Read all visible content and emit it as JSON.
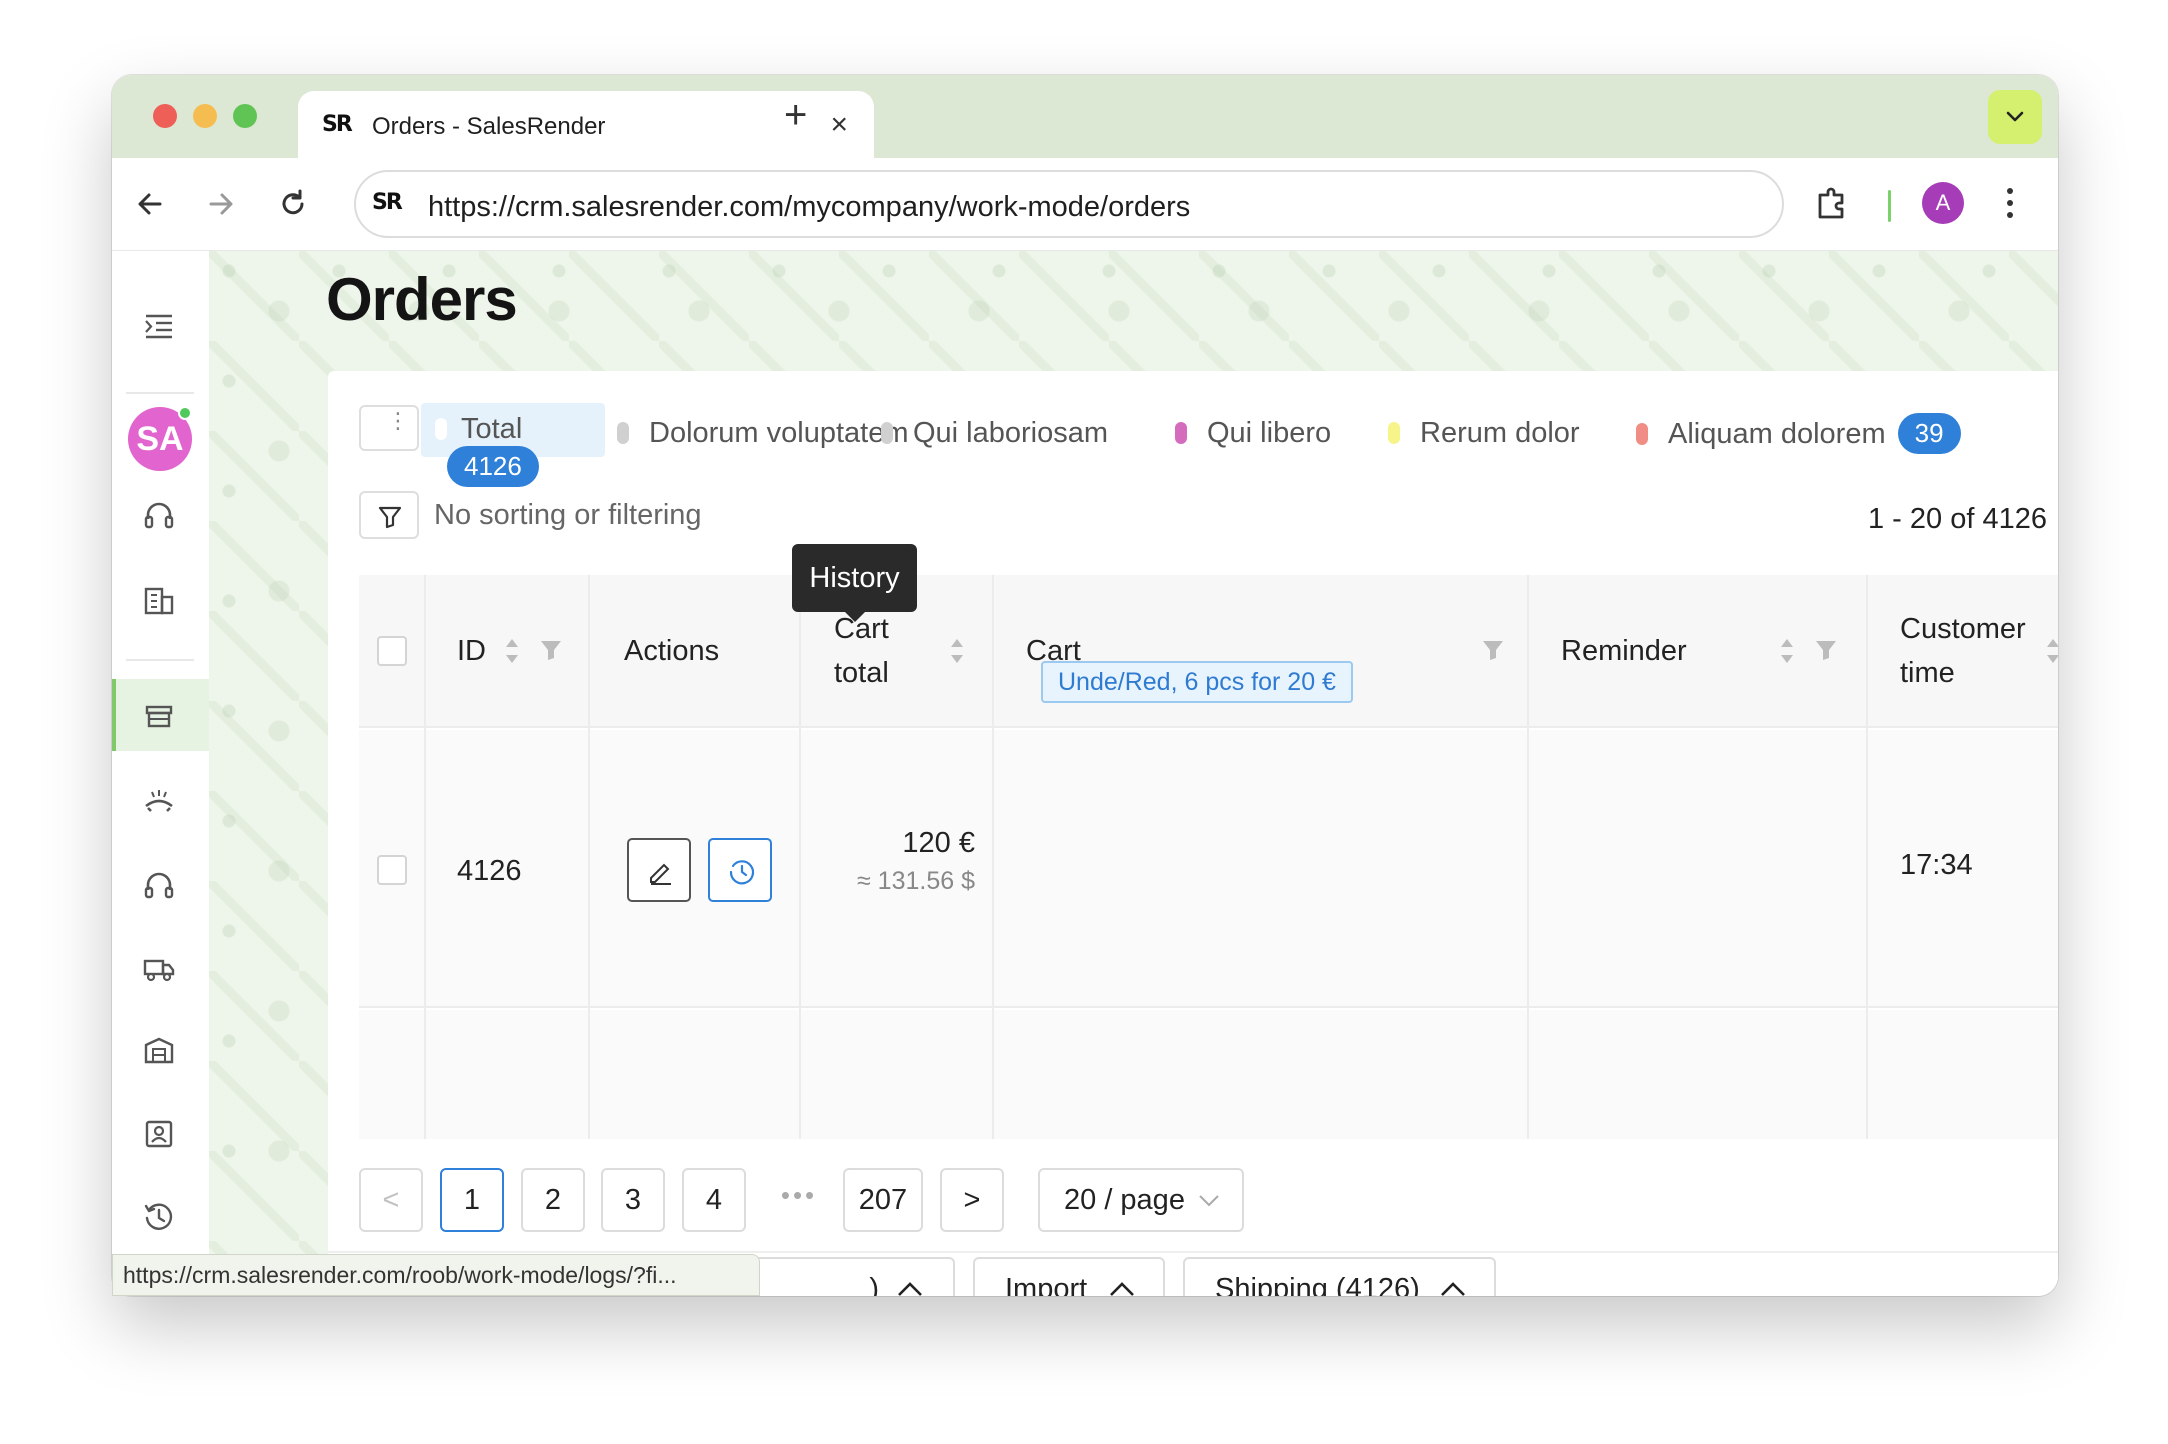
{
  "browser": {
    "tab_title": "Orders - SalesRender",
    "favicon": "SR",
    "close_tab": "×",
    "new_tab": "+",
    "url": "https://crm.salesrender.com/mycompany/work-mode/orders",
    "profile_initial": "A",
    "status_link": "https://crm.salesrender.com/roob/work-mode/logs/?fi..."
  },
  "sidebar": {
    "avatar_initials": "SA",
    "icons": [
      "menu-icon",
      "headset-icon",
      "company-icon",
      "store-icon",
      "call-icon",
      "headphones-icon",
      "truck-icon",
      "warehouse-icon",
      "contact-icon",
      "history-icon"
    ]
  },
  "page": {
    "title": "Orders"
  },
  "status_tabs": [
    {
      "label": "Total",
      "count": "4126",
      "color": "#ffffff"
    },
    {
      "label": "Dolorum voluptatem",
      "color": "#d0d0d0"
    },
    {
      "label": "Qui laboriosam",
      "color": "#d0d0d0"
    },
    {
      "label": "Qui libero",
      "color": "#d46bbd"
    },
    {
      "label": "Rerum dolor",
      "color": "#f7f48a"
    },
    {
      "label": "Aliquam dolorem",
      "count": "39",
      "color": "#f08e86"
    }
  ],
  "filter": {
    "text": "No sorting or filtering",
    "range": "1 - 20 of 4126",
    "sum_symbol": "Σ"
  },
  "table": {
    "headers": {
      "id": "ID",
      "actions": "Actions",
      "cart_total_line1": "Cart",
      "cart_total_line2": "total",
      "cart": "Cart",
      "reminder": "Reminder",
      "customer_time_line1": "Customer",
      "customer_time_line2": "time"
    },
    "rows": [
      {
        "id": "4126",
        "cart_total": "120 €",
        "cart_total_converted": "≈ 131.56 $",
        "cart_item": "Unde/Red, 6 pcs for 20 €",
        "reminder": "",
        "customer_time": "17:34"
      }
    ],
    "tooltip": "History"
  },
  "pagination": {
    "prev": "<",
    "pages": [
      "1",
      "2",
      "3",
      "4"
    ],
    "ellipsis": "•••",
    "last_page": "207",
    "next": ">",
    "page_size": "20 / page",
    "current": "1"
  },
  "bottom_buttons": [
    {
      "label": "Import"
    },
    {
      "label": "Shipping (4126)"
    }
  ],
  "bottom_partial_label": ")",
  "colors": {
    "accent": "#2f80d9",
    "sidebar_active": "#e7f3e2",
    "titlebar": "#dce8d4"
  }
}
